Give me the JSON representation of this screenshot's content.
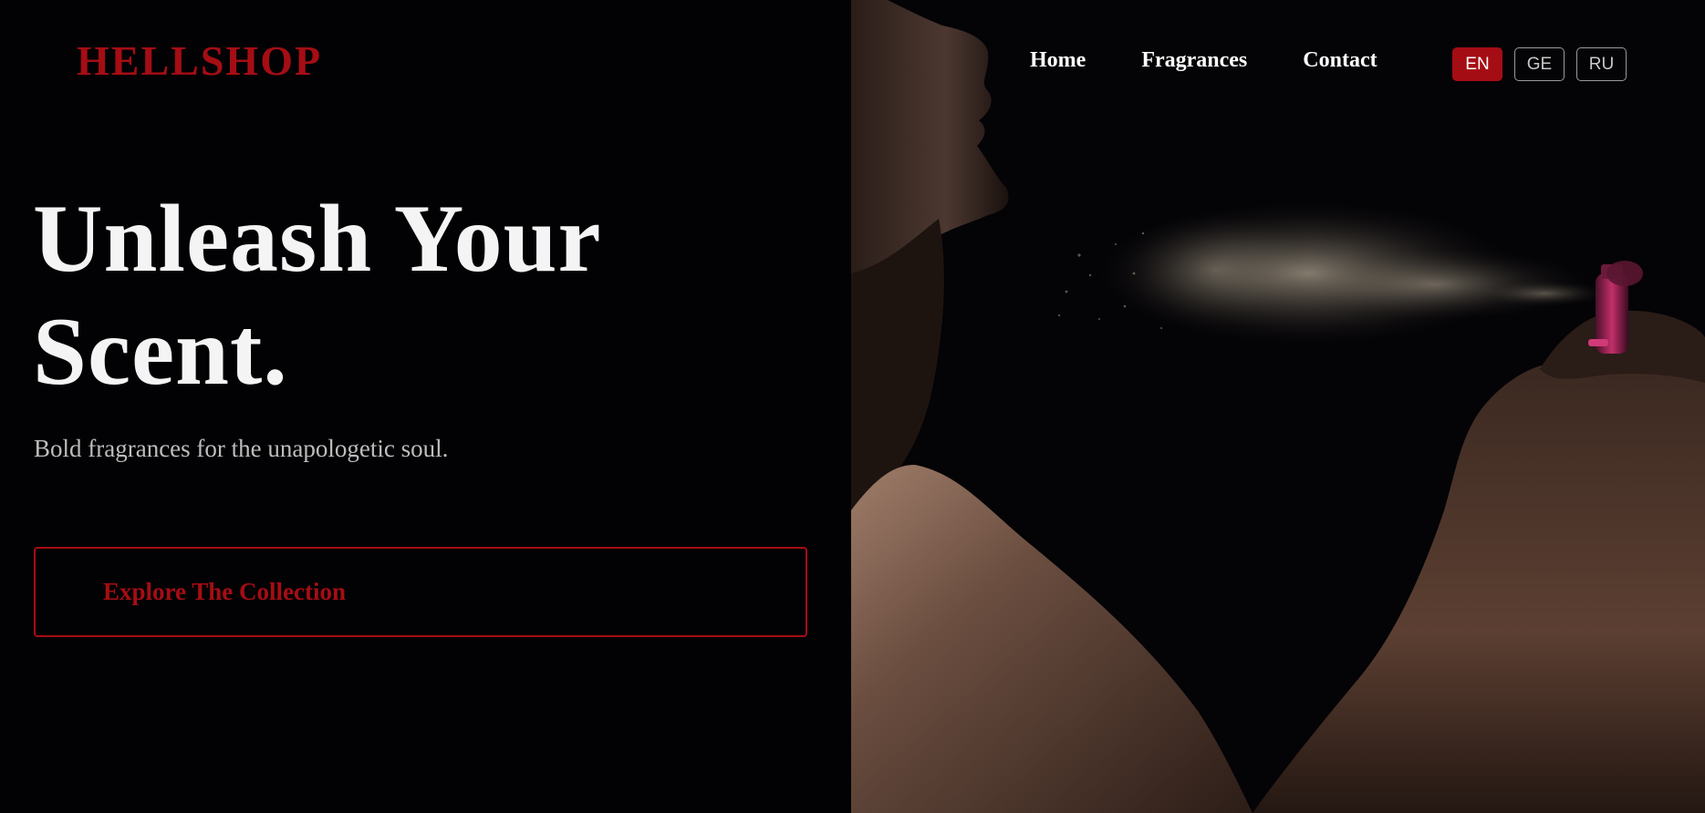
{
  "brand": {
    "logo_text": "HELLSHOP",
    "accent_color": "#a50d14"
  },
  "nav": {
    "items": [
      {
        "label": "Home"
      },
      {
        "label": "Fragrances"
      },
      {
        "label": "Contact"
      }
    ]
  },
  "languages": {
    "options": [
      "EN",
      "GE",
      "RU"
    ],
    "selected": "EN"
  },
  "hero": {
    "title_line1": "Unleash Your",
    "title_line2": "Scent.",
    "subtitle": "Bold fragrances for the unapologetic soul.",
    "cta_label": "Explore The Collection"
  },
  "colors": {
    "background": "#020204",
    "text_primary": "#f4f4f4",
    "text_secondary": "#bdbdbd",
    "bottle_accent": "#c2306a"
  }
}
